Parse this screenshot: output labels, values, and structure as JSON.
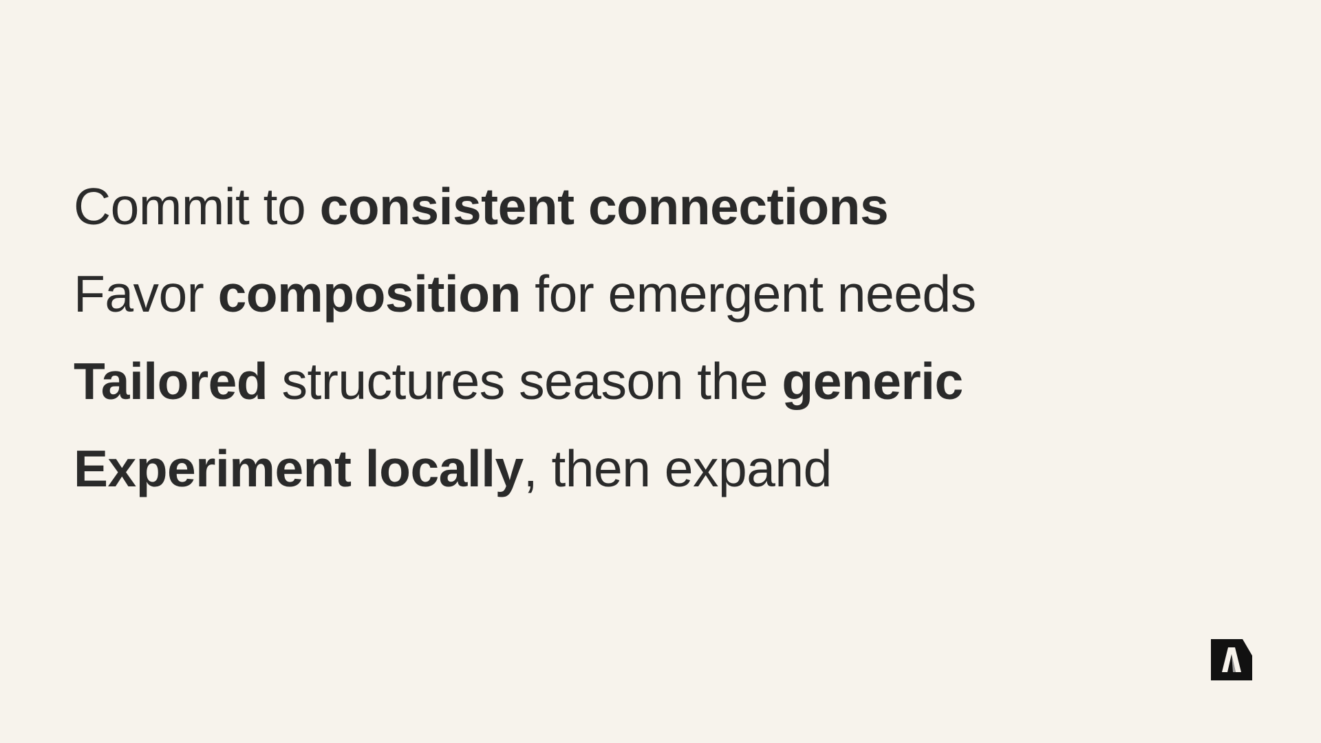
{
  "lines": [
    [
      {
        "text": "Commit to ",
        "weight": "reg"
      },
      {
        "text": "consistent connections",
        "weight": "bold"
      }
    ],
    [
      {
        "text": "Favor ",
        "weight": "reg"
      },
      {
        "text": "composition",
        "weight": "bold"
      },
      {
        "text": " for emergent needs",
        "weight": "reg"
      }
    ],
    [
      {
        "text": "Tailored",
        "weight": "bold"
      },
      {
        "text": " structures season the ",
        "weight": "reg"
      },
      {
        "text": "generic",
        "weight": "bold"
      }
    ],
    [
      {
        "text": "Experiment locally",
        "weight": "bold"
      },
      {
        "text": ", then expand",
        "weight": "reg"
      }
    ]
  ],
  "colors": {
    "background": "#f7f3ec",
    "text": "#2a2a2a",
    "logo": "#111111"
  },
  "logo": {
    "icon": "brand-a-logo-icon"
  }
}
